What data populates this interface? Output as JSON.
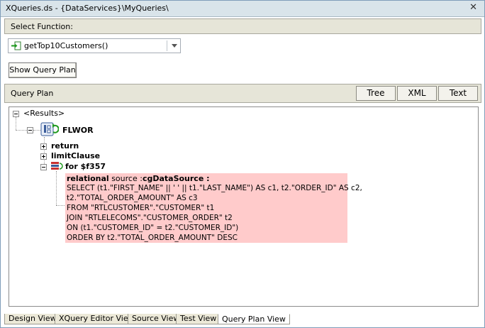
{
  "window": {
    "title": "XQueries.ds - {DataServices}\\MyQueries\\",
    "close_glyph": "✕"
  },
  "select_function": {
    "label": "Select Function:",
    "selected": "getTop10Customers()"
  },
  "show_query_plan_label": "Show Query Plan",
  "query_plan": {
    "label": "Query Plan",
    "view_buttons": [
      "Tree",
      "XML",
      "Text"
    ]
  },
  "tree": {
    "root": "<Results>",
    "flwor": "FLWOR",
    "return": "return",
    "limit_clause": "limitClause",
    "for_node": "for $f357",
    "relational_keyword": "relational",
    "source_text": "source :",
    "source_name": "cgDataSource :",
    "sql_lines": [
      "SELECT (t1.\"FIRST_NAME\" || ' ' || t1.\"LAST_NAME\") AS c1, t2.\"ORDER_ID\" AS c2,",
      "t2.\"TOTAL_ORDER_AMOUNT\" AS c3",
      "FROM \"RTLCUSTOMER\".\"CUSTOMER\" t1",
      "JOIN \"RTLELECOMS\".\"CUSTOMER_ORDER\" t2",
      "ON (t1.\"CUSTOMER_ID\" = t2.\"CUSTOMER_ID\")",
      "ORDER BY t2.\"TOTAL_ORDER_AMOUNT\" DESC"
    ]
  },
  "tabs": [
    "Design View",
    "XQuery Editor View",
    "Source View",
    "Test View",
    "Query Plan View"
  ],
  "active_tab": "Query Plan View",
  "colors": {
    "sql_highlight": "#ffcbcb",
    "title_bg": "#d9e4ea",
    "section_bg": "#e6e5d8"
  }
}
